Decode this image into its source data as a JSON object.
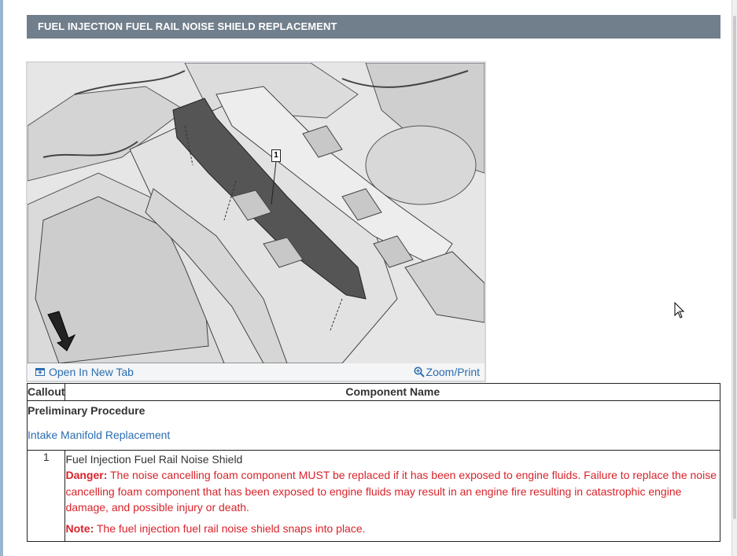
{
  "header": {
    "title": "FUEL INJECTION FUEL RAIL NOISE SHIELD REPLACEMENT"
  },
  "figure": {
    "callout_label": "1",
    "open_tab_label": "Open In New Tab",
    "zoom_label": "Zoom/Print"
  },
  "table": {
    "headers": {
      "callout": "Callout",
      "component": "Component Name"
    },
    "preliminary": {
      "title": "Preliminary Procedure",
      "link": "Intake Manifold Replacement"
    },
    "rows": [
      {
        "callout": "1",
        "name": "Fuel Injection Fuel Rail Noise Shield",
        "danger_label": "Danger:",
        "danger_text": "The noise cancelling foam component MUST be replaced if it has been exposed to engine fluids. Failure to replace the noise cancelling foam component that has been exposed to engine fluids may result in an engine fire resulting in catastrophic engine damage, and possible injury or death.",
        "note_label": "Note:",
        "note_text": "The fuel injection fuel rail noise shield snaps into place."
      }
    ]
  },
  "colors": {
    "header_bg": "#717e8c",
    "link": "#2a6db0",
    "danger": "#d8232a"
  },
  "icons": {
    "open_tab": "open-new-tab-icon",
    "zoom": "zoom-in-icon",
    "cursor": "mouse-pointer-icon"
  }
}
